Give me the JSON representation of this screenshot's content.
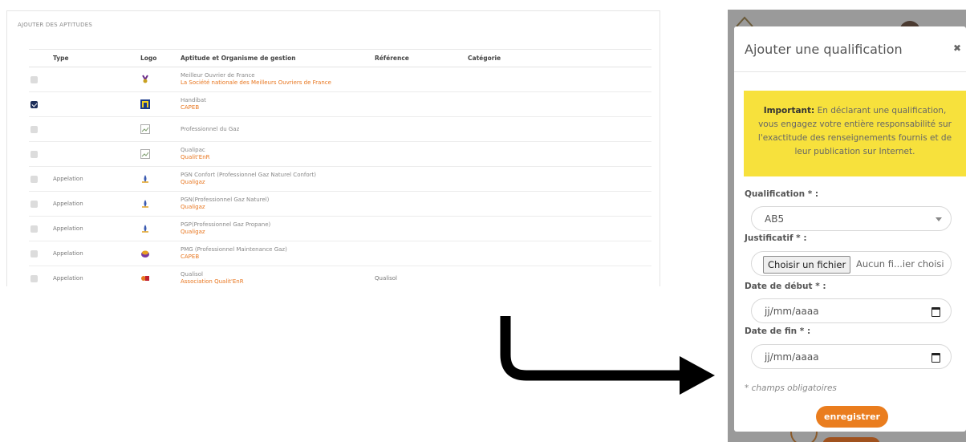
{
  "panel": {
    "title": "AJOUTER DES APTITUDES",
    "headers": {
      "type": "Type",
      "logo": "Logo",
      "aptitude": "Aptitude et Organisme de gestion",
      "reference": "Référence",
      "categorie": "Catégorie"
    },
    "rows": [
      {
        "checked": false,
        "type": "",
        "logo": "moaf-logo-icon",
        "name": "Meilleur Ouvrier de France",
        "org": "La Société nationale des Meilleurs Ouvriers de France",
        "ref": ""
      },
      {
        "checked": true,
        "type": "",
        "logo": "handibat-logo-icon",
        "name": "Handibat",
        "org": "CAPEB",
        "ref": ""
      },
      {
        "checked": false,
        "type": "",
        "logo": "broken-image-icon",
        "name": "Professionnel du Gaz",
        "org": "",
        "ref": ""
      },
      {
        "checked": false,
        "type": "",
        "logo": "broken-image-icon",
        "name": "Qualipac",
        "org": "Qualit'EnR",
        "ref": ""
      },
      {
        "checked": false,
        "type": "Appelation",
        "logo": "flame-logo-icon",
        "name": "PGN Confort (Professionnel Gaz Naturel Confort)",
        "org": "Qualigaz",
        "ref": ""
      },
      {
        "checked": false,
        "type": "Appelation",
        "logo": "flame-logo-icon",
        "name": "PGN(Professionnel Gaz Naturel)",
        "org": "Qualigaz",
        "ref": ""
      },
      {
        "checked": false,
        "type": "Appelation",
        "logo": "flame-logo-icon",
        "name": "PGP(Professionnel Gaz Propane)",
        "org": "Qualigaz",
        "ref": ""
      },
      {
        "checked": false,
        "type": "Appelation",
        "logo": "pmg-logo-icon",
        "name": "PMG (Professionnel Maintenance Gaz)",
        "org": "CAPEB",
        "ref": ""
      },
      {
        "checked": false,
        "type": "Appelation",
        "logo": "qualisol-logo-icon",
        "name": "Qualisol",
        "org": "Association Qualit'EnR",
        "ref": "Qualisol"
      }
    ]
  },
  "modal": {
    "title": "Ajouter une qualification",
    "close": "✖",
    "notice_bold": "Important:",
    "notice_text": " En déclarant une qualification, vous engagez votre entière responsabilité sur l'exactitude des renseignements fournis et de leur publication sur Internet.",
    "qualification_label": "Qualification * :",
    "qualification_value": "AB5",
    "justificatif_label": "Justificatif * :",
    "file_button": "Choisir un fichier",
    "file_info": "Aucun fi...ier choisi",
    "date_debut_label": "Date de début * :",
    "date_debut_placeholder": "jj/mm/aaaa",
    "date_fin_label": "Date de fin * :",
    "date_fin_placeholder": "jj/mm/aaaa",
    "required_hint": "* champs obligatoires",
    "save_label": "enregistrer"
  },
  "colors": {
    "accent": "#ea7d1e",
    "notice_bg": "#f7e13c",
    "checkbox_checked": "#1e2f5a",
    "org_text": "#e8761f"
  }
}
